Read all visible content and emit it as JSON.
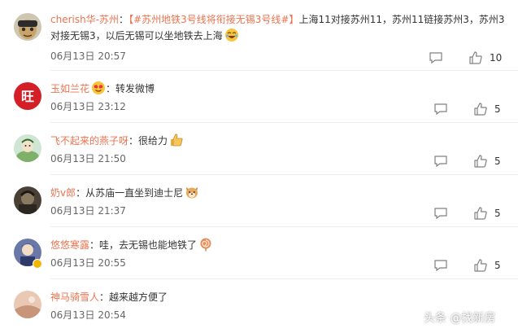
{
  "comments": [
    {
      "username": "cherish华-苏州",
      "separator": "：",
      "link": "【#苏州地铁3号线将衔接无锡3号线#】",
      "text1": "上海11对接苏州11，苏州11链接苏州3，苏州3",
      "text2": "对接无锡3，以后无锡可以坐地铁去上海",
      "emoji": "laughing-emoji",
      "time": "06月13日 20:57",
      "likes": "10"
    },
    {
      "username": "玉如兰花",
      "separator": "：",
      "text1": "转发微博",
      "emoji": "heart-eyes-emoji",
      "time": "06月13日 23:12",
      "likes": "5"
    },
    {
      "username": "飞不起来的燕子呀",
      "separator": "：",
      "text1": "很给力",
      "emoji": "thumbs-up-emoji",
      "time": "06月13日 21:50",
      "likes": "5"
    },
    {
      "username": "奶v郎",
      "separator": "：",
      "text1": "从苏庙一直坐到迪士尼",
      "emoji": "dog-face-emoji",
      "time": "06月13日 21:37",
      "likes": "5"
    },
    {
      "username": "悠悠寒露",
      "separator": "：",
      "text1": "哇，去无锡也能地铁了",
      "emoji": "lollipop-emoji",
      "time": "06月13日 20:55",
      "likes": "5"
    },
    {
      "username": "神马骑雪人",
      "separator": "：",
      "text1": "越来越方便了",
      "time": "06月13日 20:54"
    }
  ],
  "watermark": "头条 @找新房",
  "colors": {
    "username": "#eb7350",
    "text": "#333333",
    "time": "#666666",
    "icon": "#808080"
  }
}
